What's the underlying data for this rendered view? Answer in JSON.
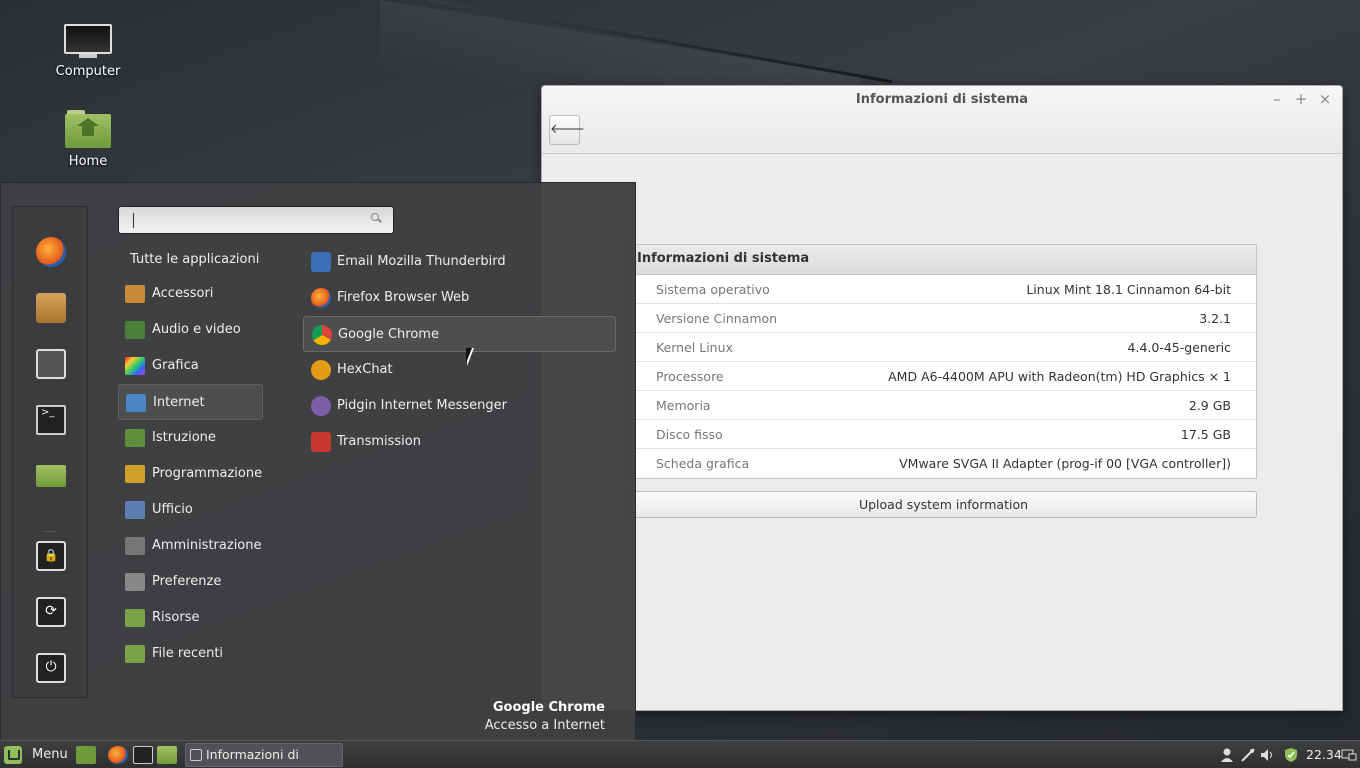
{
  "desktop": {
    "icons": [
      {
        "label": "Computer",
        "icon": "monitor-icon"
      },
      {
        "label": "Home",
        "icon": "home-folder-icon"
      }
    ]
  },
  "window": {
    "title": "Informazioni di sistema",
    "controls": {
      "minimize": "–",
      "maximize": "+",
      "close": "×"
    },
    "back_icon": "left-arrow-icon",
    "back_glyph": "🡐",
    "info_header": "Informazioni di sistema",
    "rows": [
      {
        "key": "Sistema operativo",
        "value": "Linux Mint 18.1 Cinnamon 64-bit"
      },
      {
        "key": "Versione Cinnamon",
        "value": "3.2.1"
      },
      {
        "key": "Kernel Linux",
        "value": "4.4.0-45-generic"
      },
      {
        "key": "Processore",
        "value": "AMD A6-4400M APU with Radeon(tm) HD Graphics × 1"
      },
      {
        "key": "Memoria",
        "value": "2.9 GB"
      },
      {
        "key": "Disco fisso",
        "value": "17.5 GB"
      },
      {
        "key": "Scheda grafica",
        "value": "VMware SVGA II Adapter (prog-if 00 [VGA controller])"
      }
    ],
    "upload_label": "Upload system information"
  },
  "menu": {
    "favorites": [
      "firefox-icon",
      "package-manager-icon",
      "settings-icon",
      "terminal-icon",
      "folder-icon",
      "lock-icon",
      "logout-icon",
      "power-icon"
    ],
    "search": {
      "value": "",
      "placeholder": ""
    },
    "all_apps_label": "Tutte le applicazioni",
    "categories": [
      {
        "label": "Accessori",
        "color": "#c98a3a"
      },
      {
        "label": "Audio e video",
        "color": "#4b7f3a"
      },
      {
        "label": "Grafica",
        "color": "#d04fb0"
      },
      {
        "label": "Internet",
        "color": "#4a86c7"
      },
      {
        "label": "Istruzione",
        "color": "#5f8f3a"
      },
      {
        "label": "Programmazione",
        "color": "#d1a02a"
      },
      {
        "label": "Ufficio",
        "color": "#5a7fb0"
      },
      {
        "label": "Amministrazione",
        "color": "#777777"
      },
      {
        "label": "Preferenze",
        "color": "#888888"
      },
      {
        "label": "Risorse",
        "color": "#7aa244"
      },
      {
        "label": "File recenti",
        "color": "#7aa244"
      }
    ],
    "selected_category": "Internet",
    "apps": [
      {
        "label": "Email Mozilla Thunderbird",
        "color": "#3b6fb6"
      },
      {
        "label": "Firefox Browser Web",
        "color": "#e2731a"
      },
      {
        "label": "Google Chrome",
        "color": "#4d8ef0"
      },
      {
        "label": "HexChat",
        "color": "#e39b17"
      },
      {
        "label": "Pidgin Internet Messenger",
        "color": "#7e5ea8"
      },
      {
        "label": "Transmission",
        "color": "#c8382f"
      }
    ],
    "selected_app": "Google Chrome",
    "description_title": "Google Chrome",
    "description_subtitle": "Accesso a Internet"
  },
  "taskbar": {
    "menu_label": "Menu",
    "launchers": [
      "show-desktop-icon",
      "firefox-icon",
      "terminal-icon",
      "folder-icon"
    ],
    "window_button": "Informazioni di siste...",
    "tray": [
      "user-icon",
      "network-icon",
      "volume-icon",
      "shield-icon",
      "display-icon"
    ],
    "clock": "22.34"
  }
}
